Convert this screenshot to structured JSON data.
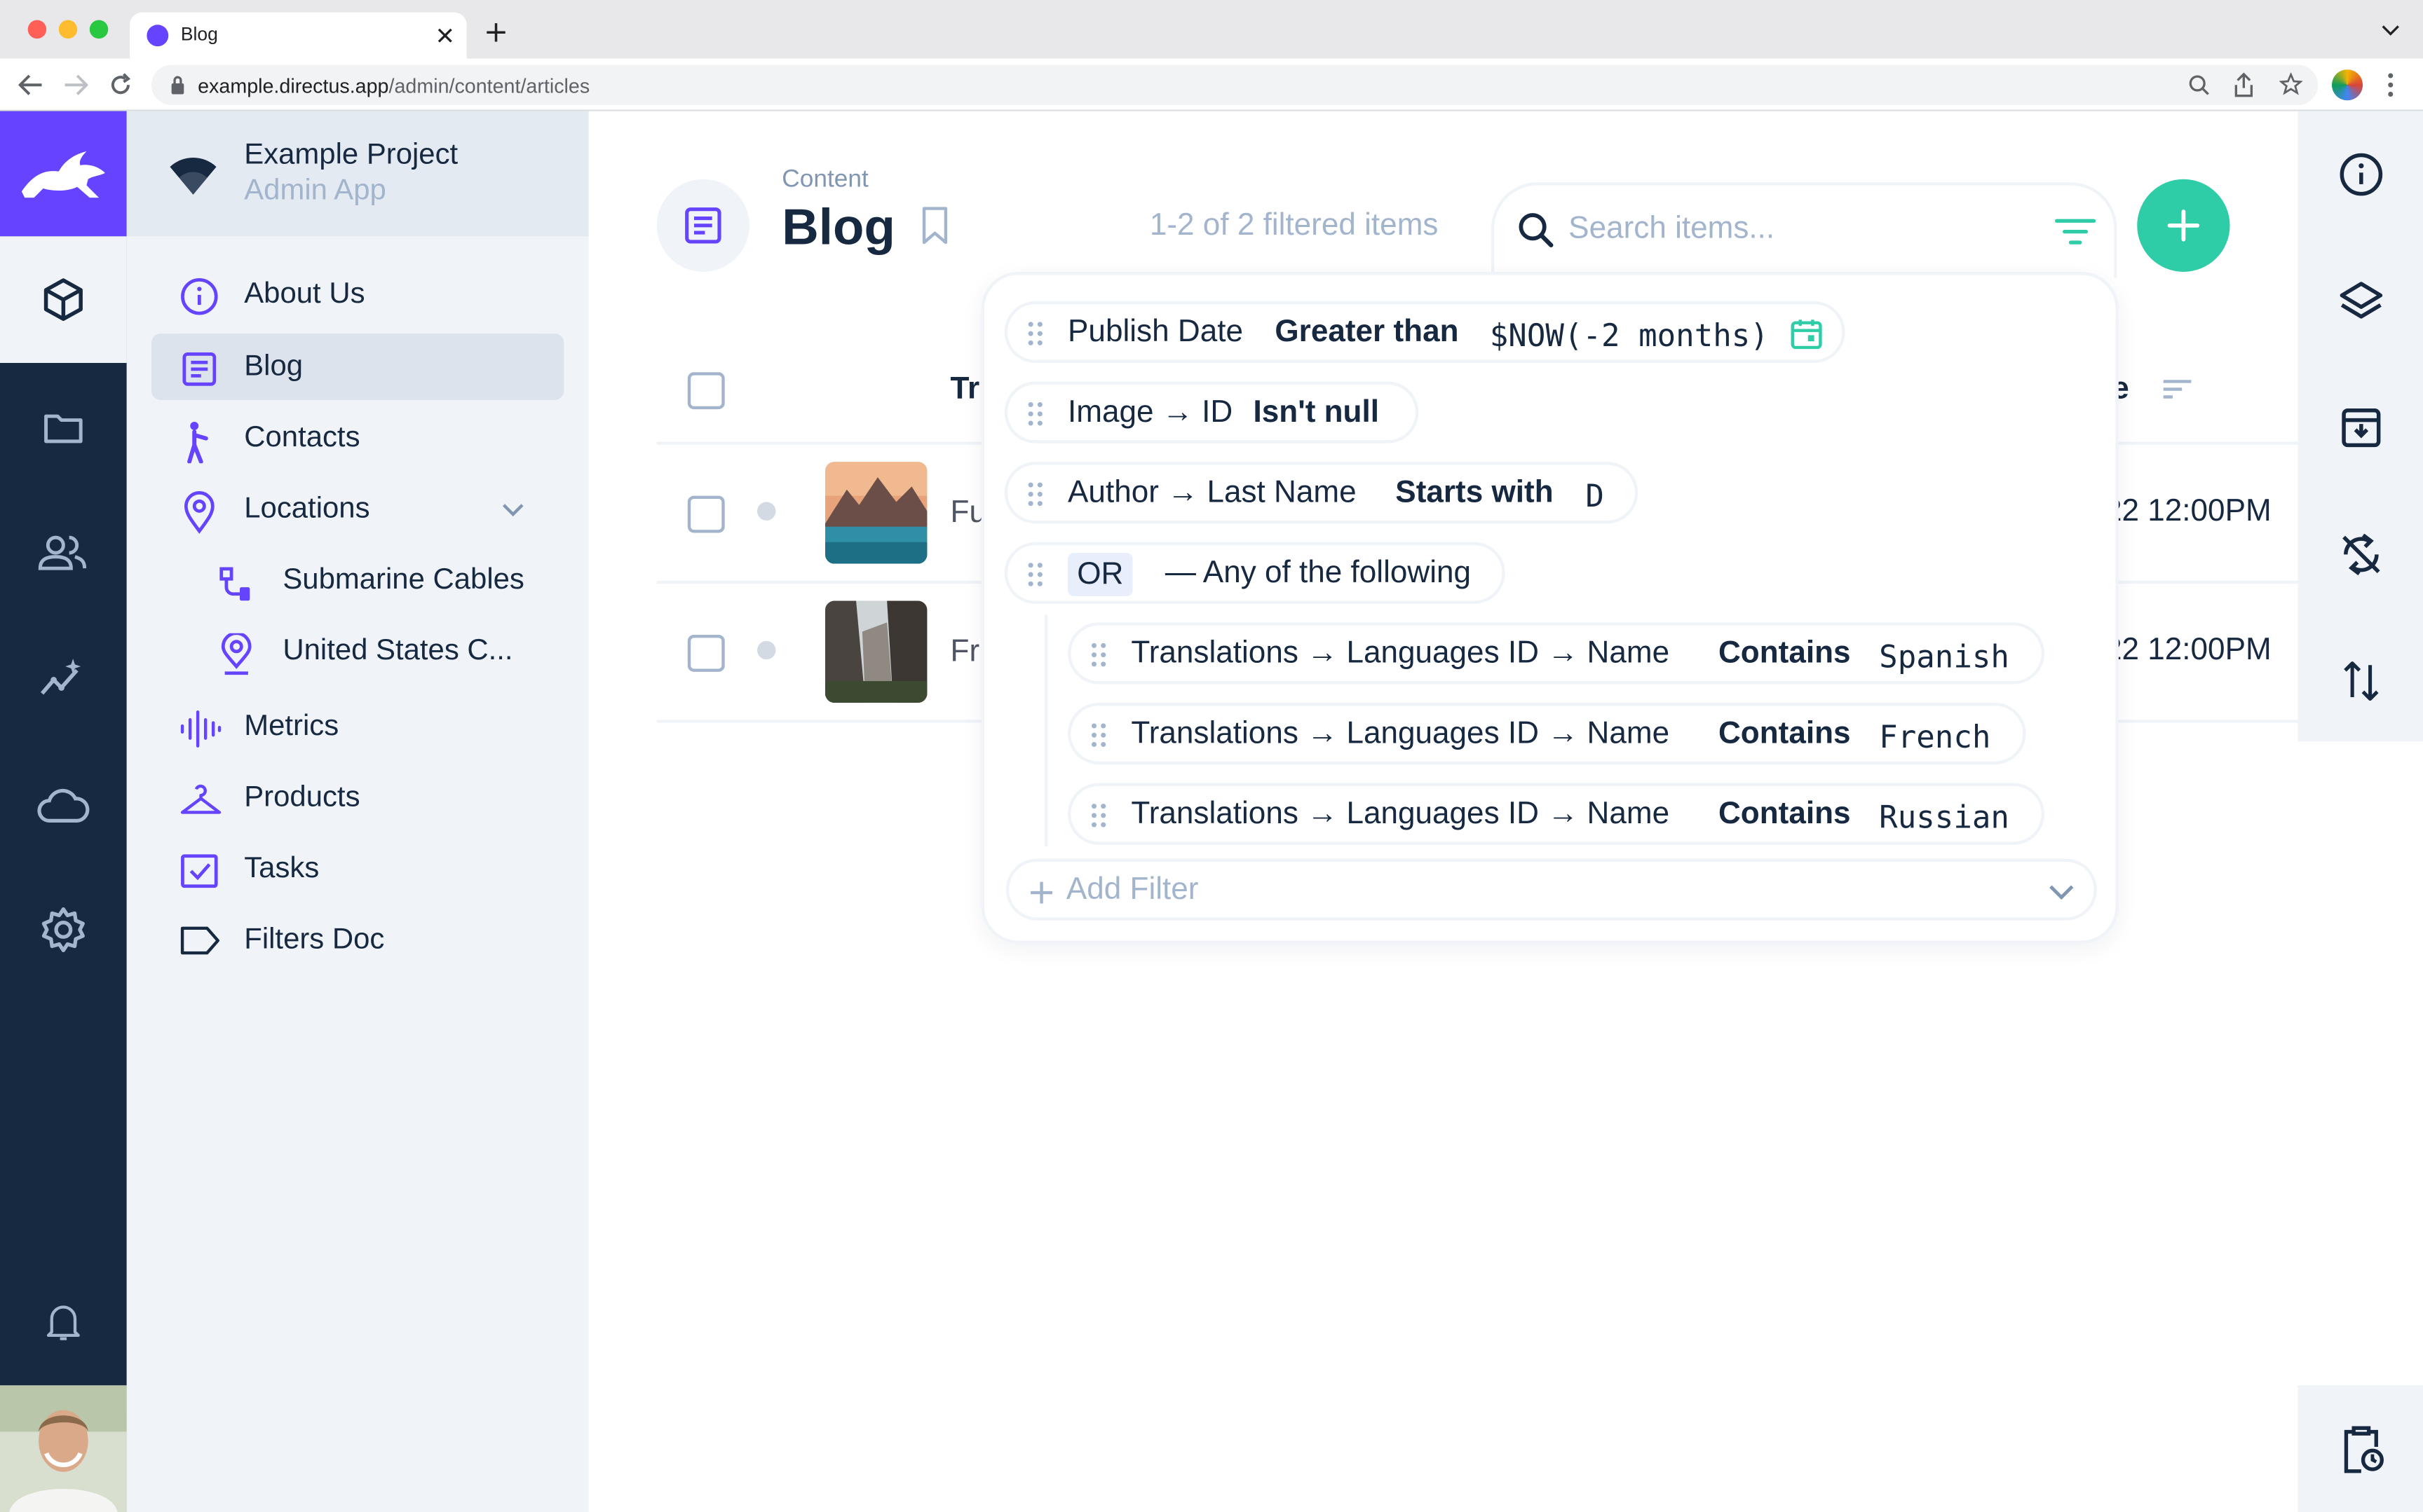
{
  "browser": {
    "tab_title": "Blog",
    "url_host": "example.directus.app",
    "url_path": "/admin/content/articles"
  },
  "project": {
    "name": "Example Project",
    "subtitle": "Admin App"
  },
  "modules": [
    {
      "icon": "content-box-icon",
      "active": true
    },
    {
      "icon": "folder-icon"
    },
    {
      "icon": "users-icon"
    },
    {
      "icon": "insights-icon"
    },
    {
      "icon": "cloud-icon"
    },
    {
      "icon": "gear-icon"
    }
  ],
  "nav": [
    {
      "label": "About Us",
      "icon": "info-icon"
    },
    {
      "label": "Blog",
      "icon": "article-icon",
      "active": true
    },
    {
      "label": "Contacts",
      "icon": "person-icon"
    },
    {
      "label": "Locations",
      "icon": "location-pin-icon",
      "expanded": true
    },
    {
      "label": "Submarine Cables",
      "icon": "cable-icon",
      "child": true
    },
    {
      "label": "United States C...",
      "icon": "location-pin-icon",
      "child": true
    },
    {
      "label": "Metrics",
      "icon": "waveform-icon"
    },
    {
      "label": "Products",
      "icon": "hanger-icon"
    },
    {
      "label": "Tasks",
      "icon": "checkbox-icon"
    },
    {
      "label": "Filters Doc",
      "icon": "label-icon"
    }
  ],
  "header": {
    "breadcrumb": "Content",
    "title": "Blog",
    "count": "1-2 of 2 filtered items",
    "search_placeholder": "Search items..."
  },
  "table": {
    "col_title_partial": "Tr",
    "col_date_partial": "te",
    "rows": [
      {
        "title_partial": "Fu",
        "date_partial": "22 12:00PM"
      },
      {
        "title_partial": "Fr",
        "date_partial": "22 12:00PM"
      }
    ]
  },
  "filters": {
    "rules": [
      {
        "field": "Publish Date",
        "operator": "Greater than",
        "value": "$NOW(-2 months)"
      },
      {
        "field": "Image → ID",
        "operator": "Isn't null",
        "value": ""
      },
      {
        "field": "Author → Last Name",
        "operator": "Starts with",
        "value": "D"
      }
    ],
    "group": {
      "logic": "OR",
      "description": "— Any of the following",
      "rules": [
        {
          "field": "Translations → Languages ID → Name",
          "operator": "Contains",
          "value": "Spanish"
        },
        {
          "field": "Translations → Languages ID → Name",
          "operator": "Contains",
          "value": "French"
        },
        {
          "field": "Translations → Languages ID → Name",
          "operator": "Contains",
          "value": "Russian"
        }
      ]
    },
    "add_label": "Add Filter"
  },
  "colors": {
    "primary": "#6644ff",
    "success": "#2ecda7",
    "nav_bg": "#f0f4f9",
    "module_bg": "#172940"
  }
}
